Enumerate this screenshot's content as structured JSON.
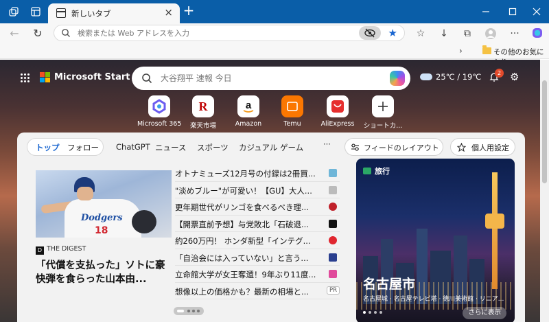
{
  "browser": {
    "tab_title": "新しいタブ",
    "omnibox_placeholder": "検索または Web アドレスを入力",
    "favorites_folder": "その他のお気に入り"
  },
  "ntp": {
    "brand": "Microsoft Start",
    "search_placeholder": "大谷翔平 速報 今日",
    "weather": "25℃ / 19℃",
    "notification_count": "2",
    "quick_links": [
      {
        "label": "Microsoft 365",
        "icon": "microsoft-365-icon"
      },
      {
        "label": "楽天市場",
        "icon": "rakuten-icon"
      },
      {
        "label": "Amazon",
        "icon": "amazon-icon"
      },
      {
        "label": "Temu",
        "icon": "temu-icon"
      },
      {
        "label": "AliExpress",
        "icon": "aliexpress-icon"
      },
      {
        "label": "ショートカ...",
        "icon": "add-shortcut-icon"
      }
    ]
  },
  "feed": {
    "tabs": {
      "top": "トップ",
      "follow": "フォロー"
    },
    "nav": [
      "ChatGPT",
      "ニュース",
      "スポーツ",
      "カジュアル ゲーム"
    ],
    "more": "···",
    "layout_button": "フィードのレイアウト",
    "personalize_button": "個人用設定",
    "hero": {
      "source": "THE DIGEST",
      "headline": "「代償を支払った」ソトに豪快弾を食らった山本由..."
    },
    "news": [
      {
        "text": "オトナミューズ12月号の付録は2冊買...",
        "color": "#6fb6d8"
      },
      {
        "text": "\"淡めブルー\"が可愛い！【GU】大人...",
        "color": "#9a9a9a"
      },
      {
        "text": "更年期世代がリンゴを食べるべき理...",
        "color": "#c0202a"
      },
      {
        "text": "【開票直前予想】与党敗北「石破退...",
        "color": "#111111"
      },
      {
        "text": "約260万円！ ホンダ新型「インテグ...",
        "color": "#e0262f"
      },
      {
        "text": "「自治会には入っていない」と言う...",
        "color": "#2a3f8f"
      },
      {
        "text": "立命館大学が女王奪還！9年ぶり11度...",
        "color": "#e04a9b"
      },
      {
        "text": "想像以上の価格かも？最新の相場と...",
        "color": "#ffffff"
      }
    ],
    "ad_label": "PR",
    "travel": {
      "tag": "旅行",
      "city": "名古屋市",
      "subtitle": "名古屋城 · 名古屋テレビ塔 · 徳川美術館 · リニア...",
      "more": "さらに表示"
    }
  },
  "colors": {
    "tabstrip": "#0a5ea8",
    "accent": "#1a66d0",
    "feed_bg": "#f2f2f2"
  }
}
